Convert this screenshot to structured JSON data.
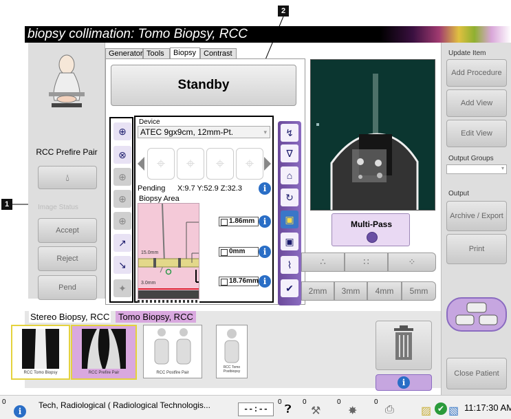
{
  "callouts": {
    "one": "1",
    "two": "2"
  },
  "window": {
    "title": "biopsy collimation:  Tomo Biopsy, RCC"
  },
  "left": {
    "view_label": "RCC Prefire Pair",
    "image_status_label": "Image Status",
    "accept": "Accept",
    "reject": "Reject",
    "pend": "Pend",
    "drop_icon": "water-drop-icon"
  },
  "tabs": [
    "Generator",
    "Tools",
    "Biopsy",
    "Contrast"
  ],
  "active_tab": "Biopsy",
  "standby": "Standby",
  "device": {
    "label": "Device",
    "selected": "ATEC 9gx9cm, 12mm-Pt.",
    "pending_label": "Pending",
    "coords": "X:9.7 Y:52.9 Z:32.3",
    "biopsy_area_label": "Biopsy Area",
    "scale_top": "15.0mm",
    "scale_bottom": "3.0mm",
    "measurements": [
      "1.86mm",
      "0mm",
      "18.76mm"
    ]
  },
  "multipass": {
    "label": "Multi-Pass"
  },
  "spacing": [
    "2mm",
    "3mm",
    "4mm",
    "5mm"
  ],
  "right": {
    "update_item": "Update Item",
    "add_procedure": "Add Procedure",
    "add_view": "Add View",
    "edit_view": "Edit View",
    "output_groups": "Output Groups",
    "output": "Output",
    "archive_export": "Archive / Export",
    "print": "Print",
    "close_patient": "Close Patient"
  },
  "thumb_tabs": [
    "Stereo Biopsy, RCC",
    "Tomo Biopsy, RCC"
  ],
  "thumbnails": [
    "RCC Tomo Biopsy",
    "RCC Prefire Pair",
    "RCC Postfire Pair",
    "RCC Tomo Postbiopsy"
  ],
  "status": {
    "count0": "0",
    "user": "Tech, Radiological ( Radiological Technologis...",
    "timer": "--:--",
    "c1": "0",
    "c2": "0",
    "c3": "0",
    "c4": "0",
    "time": "11:17:30 AM"
  },
  "colors": {
    "accent": "#7b5aa6",
    "info": "#2a6ec6",
    "titlebar": "#000000",
    "biopsy_area": "#f4c9d8"
  }
}
